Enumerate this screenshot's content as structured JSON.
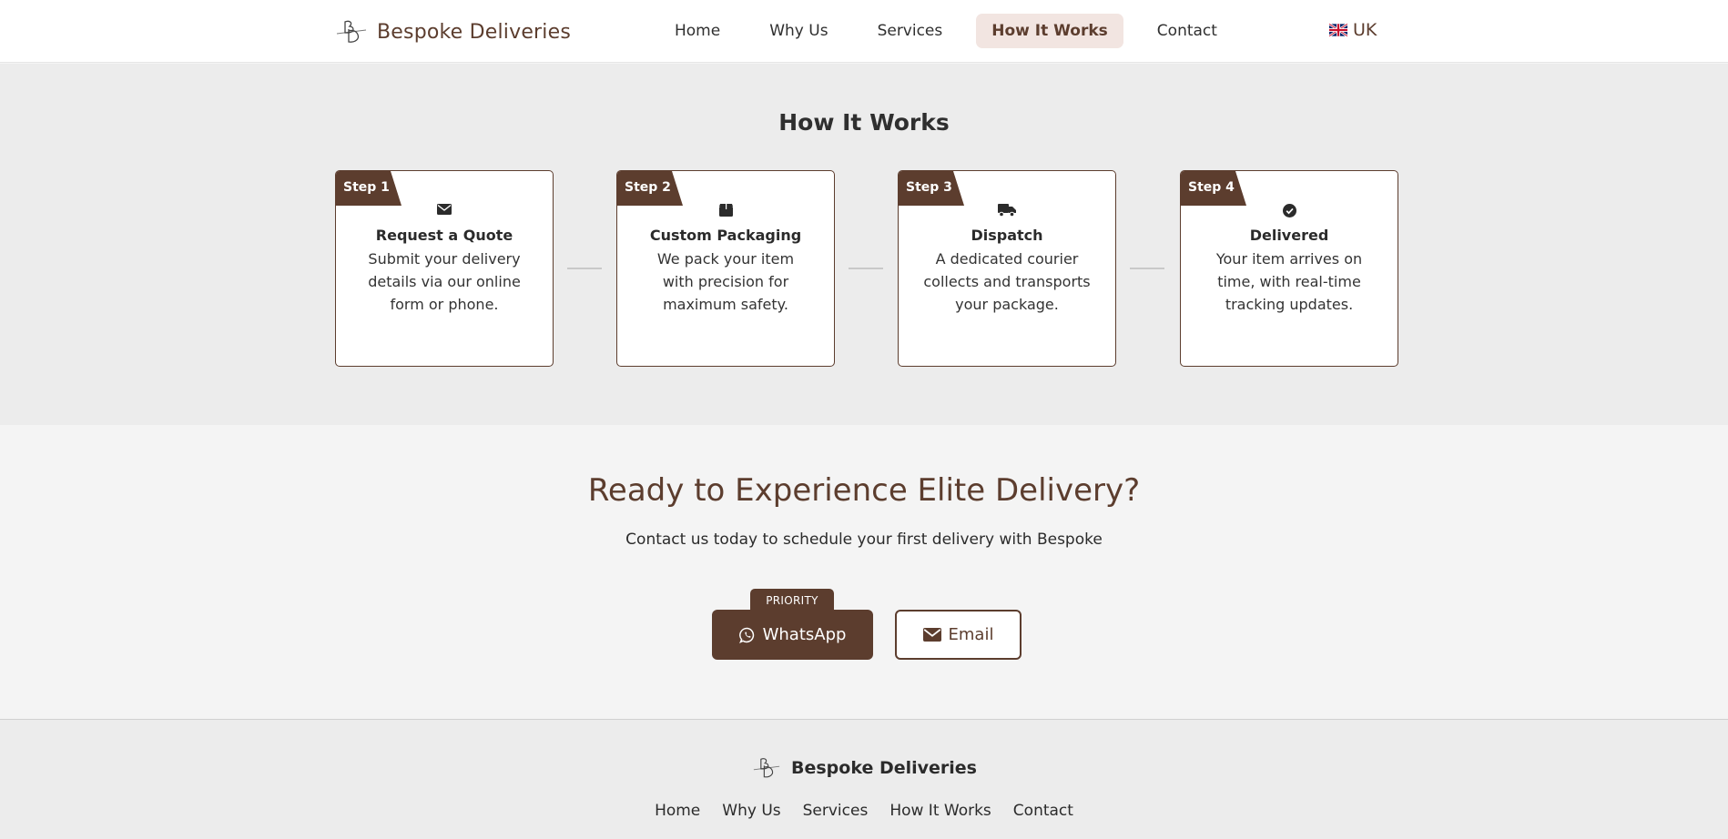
{
  "nav": {
    "brand": "Bespoke Deliveries",
    "items": [
      {
        "label": "Home"
      },
      {
        "label": "Why Us"
      },
      {
        "label": "Services"
      },
      {
        "label": "How It Works"
      },
      {
        "label": "Contact"
      }
    ],
    "active_item": "How It Works",
    "lang": "UK",
    "lang_icon": "uk-flag-icon"
  },
  "how_it_works": {
    "title": "How It Works",
    "steps": [
      {
        "tag": "Step 1",
        "icon": "envelope-icon",
        "title": "Request a Quote",
        "desc": "Submit your delivery details via our online form or phone."
      },
      {
        "tag": "Step 2",
        "icon": "box-icon",
        "title": "Custom Packaging",
        "desc": "We pack your item with precision for maximum safety."
      },
      {
        "tag": "Step 3",
        "icon": "truck-icon",
        "title": "Dispatch",
        "desc": "A dedicated courier collects and transports your package."
      },
      {
        "tag": "Step 4",
        "icon": "check-circle-icon",
        "title": "Delivered",
        "desc": "Your item arrives on time, with real-time tracking updates."
      }
    ]
  },
  "cta": {
    "title": "Ready to Experience Elite Delivery?",
    "subtitle": "Contact us today to schedule your first delivery with Bespoke",
    "priority_badge": "PRIORITY",
    "whatsapp_label": "WhatsApp",
    "email_label": "Email"
  },
  "footer": {
    "brand": "Bespoke Deliveries",
    "links": [
      {
        "label": "Home"
      },
      {
        "label": "Why Us"
      },
      {
        "label": "Services"
      },
      {
        "label": "How It Works"
      },
      {
        "label": "Contact"
      }
    ]
  },
  "colors": {
    "brand": "#5c3d2e",
    "active_bg": "#f2e5e1",
    "section_bg": "#ececec",
    "cta_bg": "#f4f4f4"
  }
}
